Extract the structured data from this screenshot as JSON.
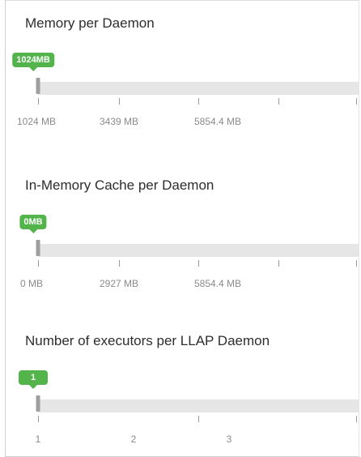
{
  "sliders": [
    {
      "title": "Memory per Daemon",
      "badge": "1024MB",
      "ticks": [
        "1024 MB",
        "3439 MB",
        "5854.4 MB"
      ]
    },
    {
      "title": "In-Memory Cache per Daemon",
      "badge": "0MB",
      "ticks": [
        "0 MB",
        "2927 MB",
        "5854.4 MB"
      ]
    },
    {
      "title": "Number of executors per LLAP Daemon",
      "badge": "1",
      "ticks": [
        "1",
        "2",
        "3"
      ]
    }
  ],
  "colors": {
    "badge": "#52b44a",
    "track": "#e6e6e6",
    "handle": "#9e9e9e"
  }
}
